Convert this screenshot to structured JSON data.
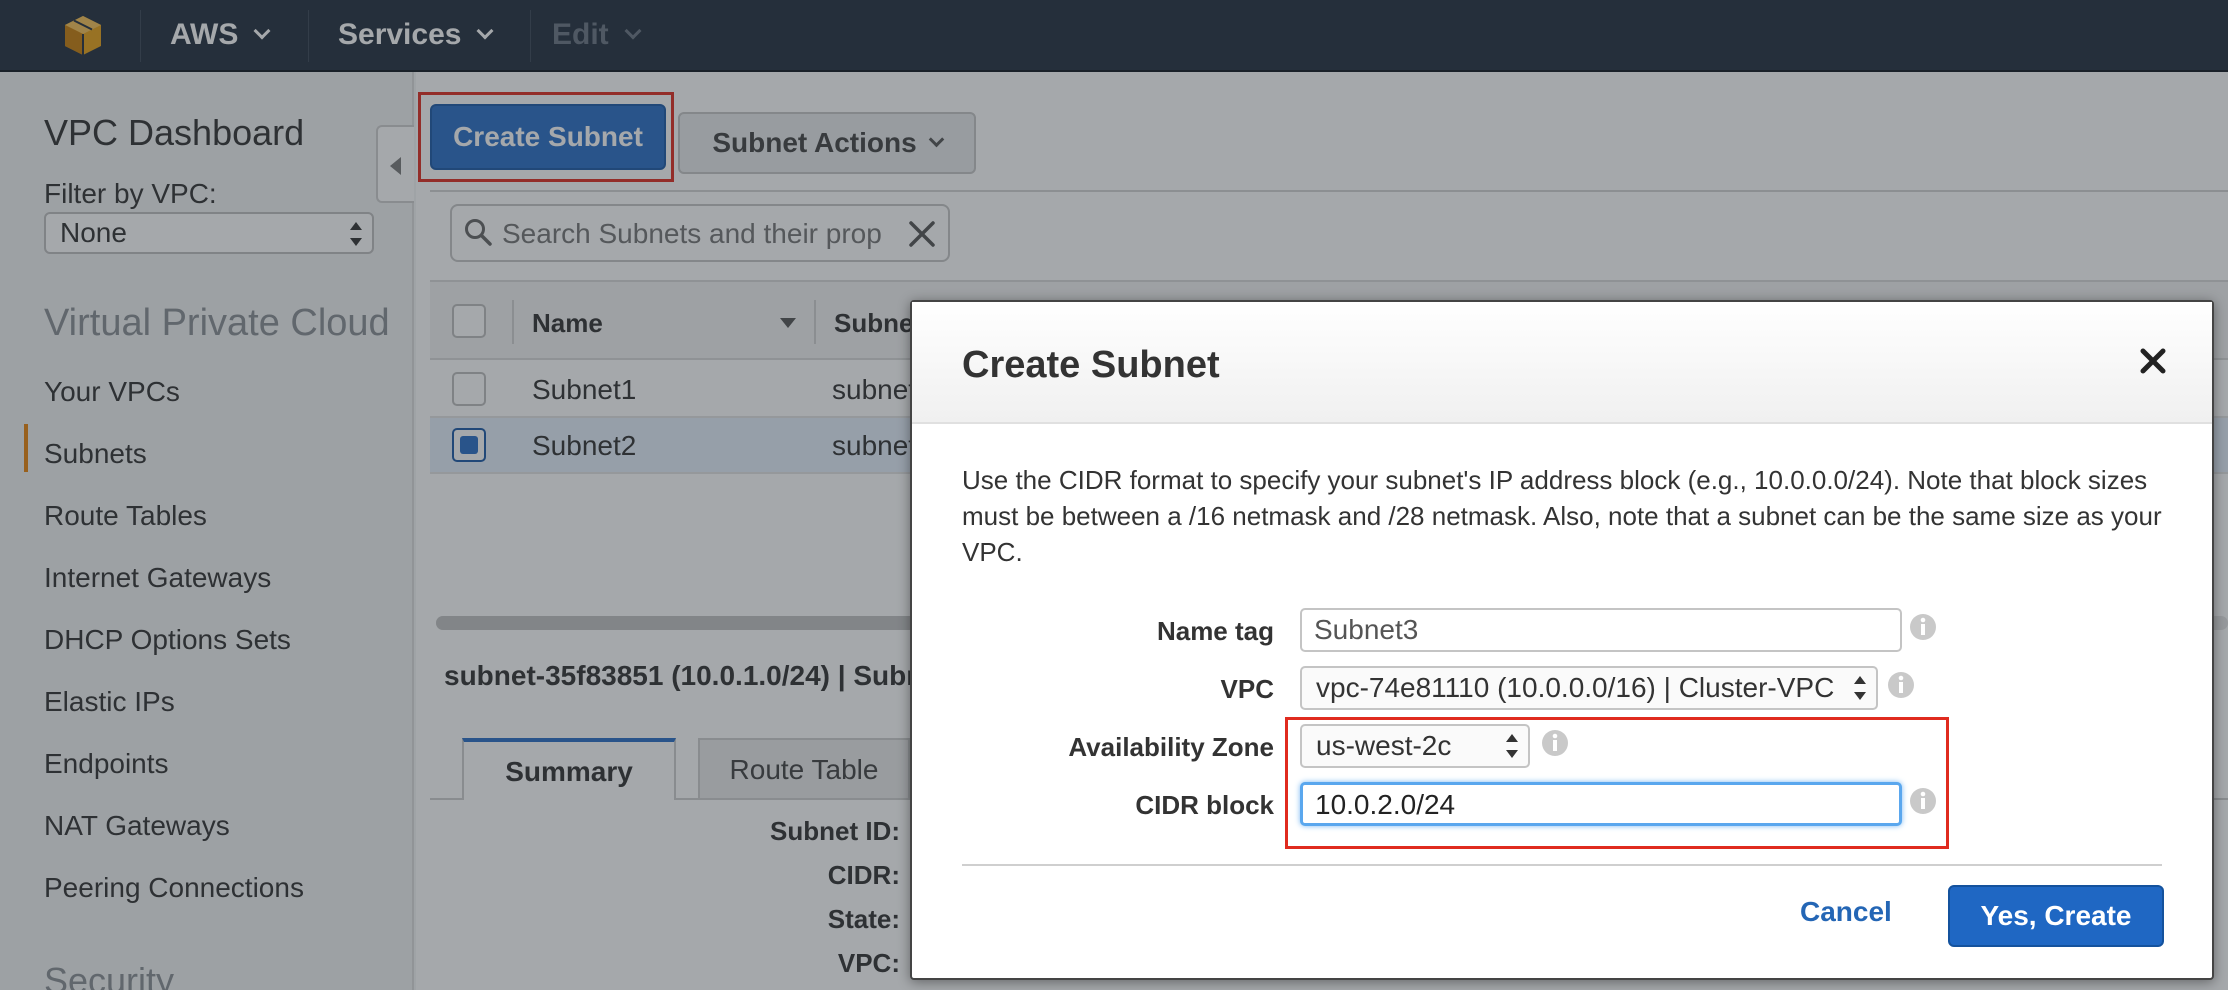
{
  "topbar": {
    "brand": "AWS",
    "services": "Services",
    "edit": "Edit",
    "icons": [
      "aws-cube-icon",
      "chevron-down-icon"
    ]
  },
  "sidebar": {
    "title": "VPC Dashboard",
    "filter_label": "Filter by VPC:",
    "filter_value": "None",
    "section": "Virtual Private Cloud",
    "items": [
      {
        "label": "Your VPCs"
      },
      {
        "label": "Subnets",
        "active": true
      },
      {
        "label": "Route Tables"
      },
      {
        "label": "Internet Gateways"
      },
      {
        "label": "DHCP Options Sets"
      },
      {
        "label": "Elastic IPs"
      },
      {
        "label": "Endpoints"
      },
      {
        "label": "NAT Gateways"
      },
      {
        "label": "Peering Connections"
      }
    ],
    "security_section": "Security"
  },
  "toolbar": {
    "create_label": "Create Subnet",
    "actions_label": "Subnet Actions"
  },
  "search": {
    "placeholder": "Search Subnets and their prop"
  },
  "table": {
    "columns": [
      "Name",
      "Subne"
    ],
    "rows": [
      {
        "name": "Subnet1",
        "id": "subnet",
        "selected": false
      },
      {
        "name": "Subnet2",
        "id": "subnet",
        "selected": true
      }
    ]
  },
  "detail": {
    "title": "subnet-35f83851 (10.0.1.0/24) | Subn",
    "tabs": [
      "Summary",
      "Route Table"
    ],
    "labels": [
      "Subnet ID:",
      "CIDR:",
      "State:",
      "VPC:"
    ]
  },
  "modal": {
    "title": "Create Subnet",
    "description": "Use the CIDR format to specify your subnet's IP address block (e.g., 10.0.0.0/24). Note that block sizes must be between a /16 netmask and /28 netmask. Also, note that a subnet can be the same size as your VPC.",
    "fields": {
      "name_tag": {
        "label": "Name tag",
        "value": "Subnet3"
      },
      "vpc": {
        "label": "VPC",
        "value": "vpc-74e81110 (10.0.0.0/16) | Cluster-VPC"
      },
      "az": {
        "label": "Availability Zone",
        "value": "us-west-2c"
      },
      "cidr": {
        "label": "CIDR block",
        "value": "10.0.2.0/24"
      }
    },
    "cancel_label": "Cancel",
    "confirm_label": "Yes, Create"
  },
  "colors": {
    "topbar": "#232f3e",
    "primary": "#2a6ec6",
    "highlight": "#e02b1f",
    "active_marker": "#e8830b"
  }
}
